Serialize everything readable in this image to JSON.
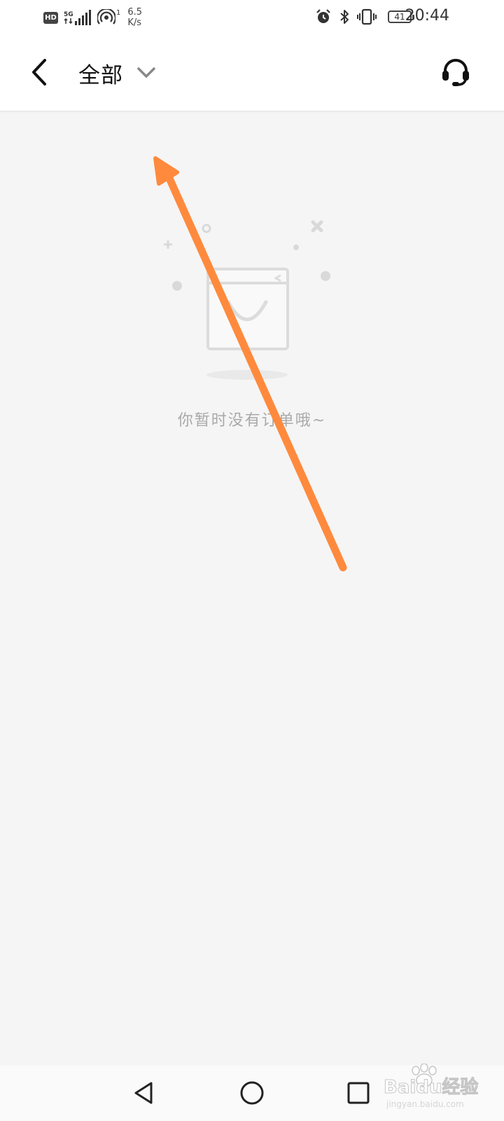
{
  "status_bar": {
    "hd_label": "HD",
    "network_label": "5G",
    "hotspot_count": "1",
    "speed_value": "6.5",
    "speed_unit": "K/s",
    "battery_level": "41",
    "time": "20:44"
  },
  "header": {
    "title": "全部"
  },
  "empty_state": {
    "message": "你暂时没有订单哦~"
  },
  "annotation": {
    "arrow_color": "#ff8a3d"
  },
  "watermark": {
    "brand": "Baidu经验",
    "url": "jingyan.baidu.com"
  }
}
